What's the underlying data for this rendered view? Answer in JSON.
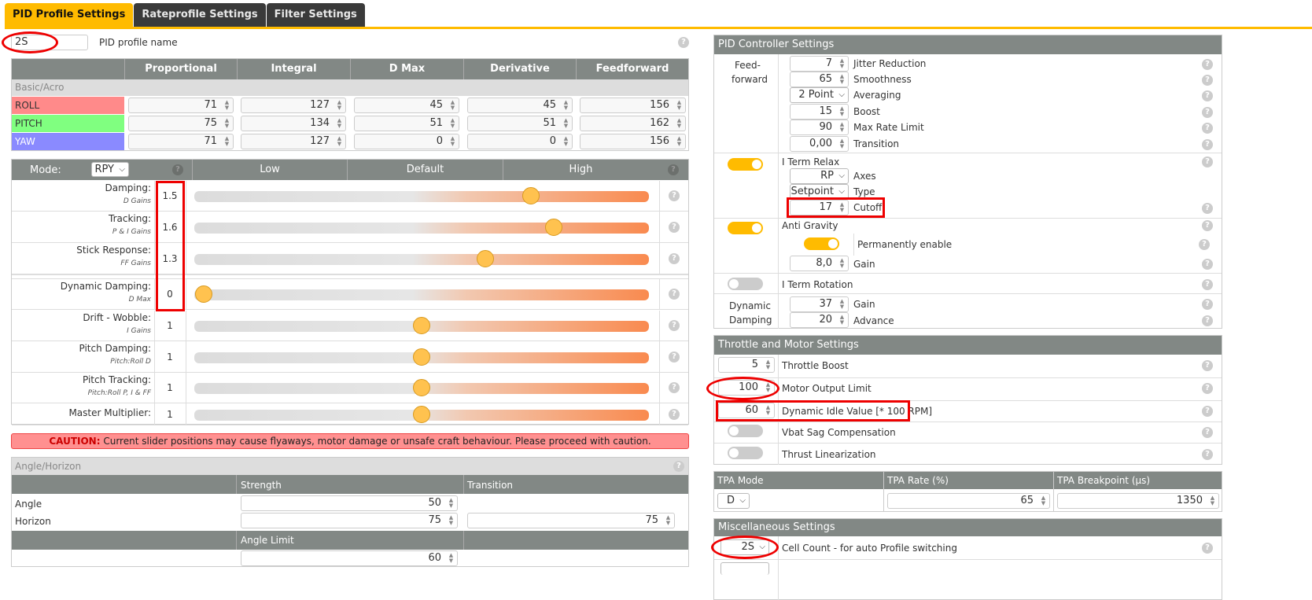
{
  "tabs": [
    "PID Profile Settings",
    "Rateprofile Settings",
    "Filter Settings"
  ],
  "profile": {
    "name": "2S",
    "name_label": "PID profile name"
  },
  "pid_table": {
    "headers": [
      "Proportional",
      "Integral",
      "D Max",
      "Derivative",
      "Feedforward"
    ],
    "section": "Basic/Acro",
    "rows": [
      {
        "axis": "ROLL",
        "color": "#ff8a8a",
        "values": [
          "71",
          "127",
          "45",
          "45",
          "156"
        ]
      },
      {
        "axis": "PITCH",
        "color": "#80ff80",
        "values": [
          "75",
          "134",
          "51",
          "51",
          "162"
        ]
      },
      {
        "axis": "YAW",
        "color": "#8a8aff",
        "values": [
          "71",
          "127",
          "0",
          "0",
          "156"
        ]
      }
    ]
  },
  "sliders": {
    "mode_label": "Mode:",
    "mode_value": "RPY",
    "columns": [
      "Low",
      "Default",
      "High"
    ],
    "items": [
      {
        "label": "Damping:",
        "sub": "D Gains",
        "value": "1.5",
        "position": 0.74
      },
      {
        "label": "Tracking:",
        "sub": "P & I Gains",
        "value": "1.6",
        "position": 0.79
      },
      {
        "label": "Stick Response:",
        "sub": "FF Gains",
        "value": "1.3",
        "position": 0.64
      },
      {
        "label": "Dynamic Damping:",
        "sub": "D Max",
        "value": "0",
        "position": 0.02
      },
      {
        "label": "Drift - Wobble:",
        "sub": "I Gains",
        "value": "1",
        "position": 0.5
      },
      {
        "label": "Pitch Damping:",
        "sub": "Pitch:Roll D",
        "value": "1",
        "position": 0.5
      },
      {
        "label": "Pitch Tracking:",
        "sub": "Pitch:Roll P, I & FF",
        "value": "1",
        "position": 0.5
      },
      {
        "label": "Master Multiplier:",
        "sub": "",
        "value": "1",
        "position": 0.5
      }
    ],
    "caution_label": "CAUTION:",
    "caution_text": " Current slider positions may cause flyaways, motor damage or unsafe craft behaviour. Please proceed with caution."
  },
  "angle_horizon": {
    "title": "Angle/Horizon",
    "headers": [
      "Strength",
      "Transition"
    ],
    "angle_label": "Angle",
    "angle_strength": "50",
    "horizon_label": "Horizon",
    "horizon_strength": "75",
    "horizon_transition": "75",
    "limit_header": "Angle Limit",
    "limit_value": "60"
  },
  "pid_controller": {
    "title": "PID Controller Settings",
    "ff_label_1": "Feed-",
    "ff_label_2": "forward",
    "ff_items": [
      {
        "value": "7",
        "label": "Jitter Reduction"
      },
      {
        "value": "65",
        "label": "Smoothness"
      },
      {
        "value": "2 Point",
        "label": "Averaging"
      },
      {
        "value": "15",
        "label": "Boost"
      },
      {
        "value": "90",
        "label": "Max Rate Limit"
      },
      {
        "value": "0,00",
        "label": "Transition"
      }
    ],
    "iterm_relax": "I Term Relax",
    "iterm_relax_enabled": true,
    "axes_value": "RP",
    "axes_label": "Axes",
    "type_value": "Setpoint",
    "type_label": "Type",
    "cutoff_value": "17",
    "cutoff_label": "Cutoff",
    "anti_gravity": "Anti Gravity",
    "anti_gravity_enabled": true,
    "perm_label": "Permanently enable",
    "ag_gain": "8,0",
    "ag_gain_label": "Gain",
    "iterm_rotation": "I Term Rotation",
    "dyn_label_1": "Dynamic",
    "dyn_label_2": "Damping",
    "dyn_gain": "37",
    "dyn_gain_label": "Gain",
    "dyn_adv": "20",
    "dyn_adv_label": "Advance"
  },
  "throttle": {
    "title": "Throttle and Motor Settings",
    "items": [
      {
        "value": "5",
        "label": "Throttle Boost"
      },
      {
        "value": "100",
        "label": "Motor Output Limit"
      },
      {
        "value": "60",
        "label": "Dynamic Idle Value [* 100 RPM]"
      }
    ],
    "vbat": "Vbat Sag Compensation",
    "thrust": "Thrust Linearization"
  },
  "tpa": {
    "headers": [
      "TPA Mode",
      "TPA Rate (%)",
      "TPA Breakpoint (µs)"
    ],
    "mode": "D",
    "rate": "65",
    "breakpoint": "1350"
  },
  "misc": {
    "title": "Miscellaneous Settings",
    "cell_value": "2S",
    "cell_label": "Cell Count - for auto Profile switching"
  }
}
